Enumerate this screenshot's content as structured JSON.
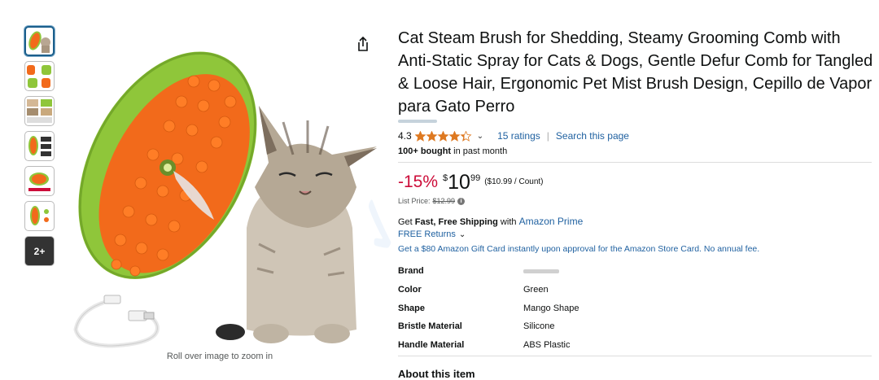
{
  "product": {
    "title": "Cat Steam Brush for Shedding, Steamy Grooming Comb with Anti-Static Spray for Cats & Dogs, Gentle Defur Comb for Tangled & Loose Hair, Ergonomic Pet Mist Brush Design, Cepillo de Vapor para Gato Perro",
    "rating_value": "4.3",
    "rating_stars": 4.3,
    "ratings_link": "15 ratings",
    "separator": "|",
    "search_link": "Search this page",
    "bought_bold": "100+ bought",
    "bought_rest": " in past month"
  },
  "gallery": {
    "more_label": "2+",
    "zoom_hint": "Roll over image to zoom in"
  },
  "price": {
    "discount": "-15%",
    "symbol": "$",
    "whole": "10",
    "fraction": "99",
    "per_unit": "($10.99 / Count)",
    "list_label": "List Price:",
    "list_value": "$12.99"
  },
  "shipping": {
    "prefix": "Get ",
    "bold": "Fast, Free Shipping",
    "middle": " with ",
    "prime_link": "Amazon Prime",
    "returns": "FREE Returns",
    "giftcard": "Get a $80 Amazon Gift Card instantly upon approval for the Amazon Store Card. No annual fee."
  },
  "specs": [
    {
      "key": "Brand",
      "value": ""
    },
    {
      "key": "Color",
      "value": "Green"
    },
    {
      "key": "Shape",
      "value": "Mango Shape"
    },
    {
      "key": "Bristle Material",
      "value": "Silicone"
    },
    {
      "key": "Handle Material",
      "value": "ABS Plastic"
    }
  ],
  "about_heading": "About this item",
  "colors": {
    "link": "#2162a1",
    "discount": "#cc0c39",
    "star": "#de7921",
    "brush_green": "#8fc63a",
    "brush_orange": "#f26a1b"
  }
}
